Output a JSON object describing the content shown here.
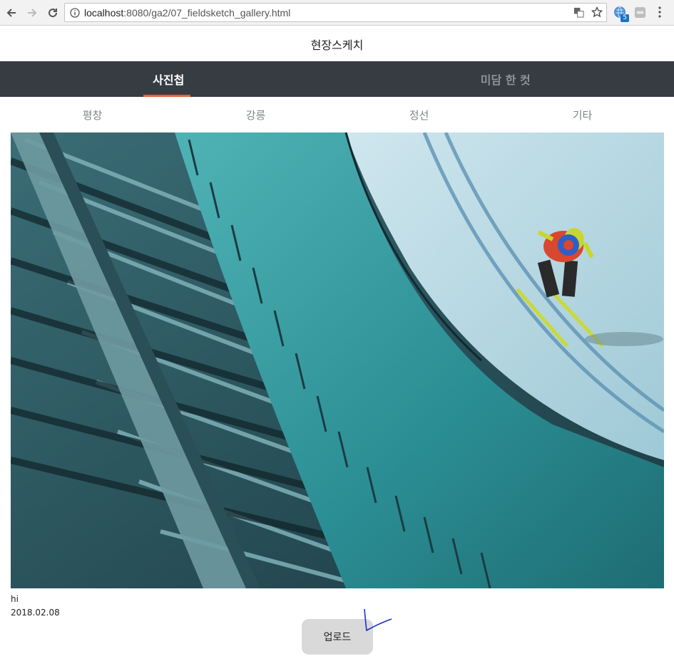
{
  "browser": {
    "url_host": "localhost",
    "url_rest": ":8080/ga2/07_fieldsketch_gallery.html",
    "extension_badge": "5"
  },
  "page": {
    "title": "현장스케치"
  },
  "main_tabs": [
    {
      "label": "사진첩",
      "active": true
    },
    {
      "label": "미담 한 컷",
      "active": false
    }
  ],
  "sub_tabs": [
    "평창",
    "강릉",
    "정선",
    "기타"
  ],
  "photo": {
    "caption": "hi",
    "date": "2018.02.08"
  },
  "upload": {
    "label": "업로드"
  },
  "colors": {
    "tab_bar": "#373c43",
    "tab_indicator": "#e8623d",
    "button": "#d9d9d9"
  }
}
